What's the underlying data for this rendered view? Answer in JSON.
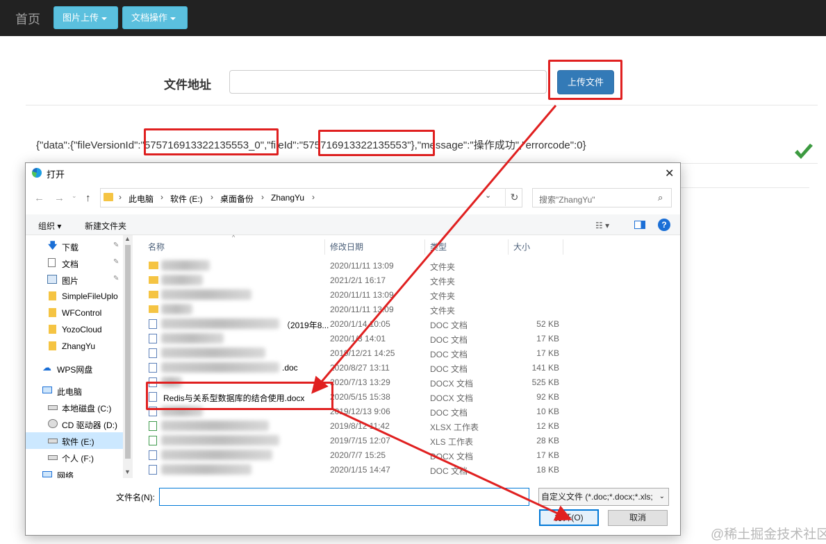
{
  "navbar": {
    "brand": "首页",
    "image_upload": "图片上传",
    "doc_ops": "文档操作"
  },
  "form": {
    "file_address_label": "文件地址",
    "file_address_value": "",
    "upload_button": "上传文件"
  },
  "result": {
    "p1": "{\"data\":{\"fileVersionId\":",
    "p2": "\"575716913322135553_0\"",
    "p3": ",\"fileId\":",
    "p4": "\"575716913322135553\"",
    "p5": "},\"message\":\"操作成功\",\"errorcode\":0}"
  },
  "dialog": {
    "title": "打开",
    "path": [
      "此电脑",
      "软件 (E:)",
      "桌面备份",
      "ZhangYu"
    ],
    "search_placeholder": "搜索\"ZhangYu\"",
    "toolbar": {
      "organize": "组织",
      "new_folder": "新建文件夹"
    },
    "nav_items": [
      {
        "label": "下载",
        "icon": "download-icon",
        "pinned": true
      },
      {
        "label": "文档",
        "icon": "document-icon",
        "pinned": true
      },
      {
        "label": "图片",
        "icon": "picture-icon",
        "pinned": true
      },
      {
        "label": "SimpleFileUplo",
        "icon": "folder-icon",
        "pinned": false
      },
      {
        "label": "WFControl",
        "icon": "folder-icon",
        "pinned": false
      },
      {
        "label": "YozoCloud",
        "icon": "folder-icon",
        "pinned": false
      },
      {
        "label": "ZhangYu",
        "icon": "folder-icon",
        "pinned": false
      },
      {
        "label": "WPS网盘",
        "icon": "cloud-icon",
        "pinned": false
      },
      {
        "label": "此电脑",
        "icon": "computer-icon",
        "pinned": false
      },
      {
        "label": "本地磁盘 (C:)",
        "icon": "drive-icon",
        "pinned": false
      },
      {
        "label": "CD 驱动器 (D:)",
        "icon": "cd-drive-icon",
        "pinned": false
      },
      {
        "label": "软件 (E:)",
        "icon": "drive-icon",
        "pinned": false,
        "selected": true
      },
      {
        "label": "个人 (F:)",
        "icon": "drive-icon",
        "pinned": false
      },
      {
        "label": "网络",
        "icon": "network-icon",
        "pinned": false
      }
    ],
    "columns": {
      "name": "名称",
      "date": "修改日期",
      "type": "类型",
      "size": "大小"
    },
    "files": [
      {
        "name": "",
        "date": "2020/11/11 13:09",
        "type": "文件夹",
        "size": "",
        "kind": "folder",
        "blurred": true
      },
      {
        "name": "",
        "date": "2021/2/1 16:17",
        "type": "文件夹",
        "size": "",
        "kind": "folder",
        "blurred": true
      },
      {
        "name": "",
        "date": "2020/11/11 13:09",
        "type": "文件夹",
        "size": "",
        "kind": "folder",
        "blurred": true
      },
      {
        "name": "",
        "date": "2020/11/11 13:09",
        "type": "文件夹",
        "size": "",
        "kind": "folder",
        "blurred": true
      },
      {
        "name": "（2019年8...",
        "date": "2020/1/14 10:05",
        "type": "DOC 文档",
        "size": "52 KB",
        "kind": "doc",
        "blurred": true
      },
      {
        "name": "",
        "date": "2020/1/3 14:01",
        "type": "DOC 文档",
        "size": "17 KB",
        "kind": "doc",
        "blurred": true
      },
      {
        "name": "",
        "date": "2019/12/21 14:25",
        "type": "DOC 文档",
        "size": "17 KB",
        "kind": "doc",
        "blurred": true
      },
      {
        "name": ".doc",
        "date": "2020/8/27 13:11",
        "type": "DOC 文档",
        "size": "141 KB",
        "kind": "doc",
        "blurred": true
      },
      {
        "name": "",
        "date": "2020/7/13 13:29",
        "type": "DOCX 文档",
        "size": "525 KB",
        "kind": "doc",
        "blurred": true
      },
      {
        "name": "Redis与关系型数据库的结合使用.docx",
        "date": "2020/5/15 15:38",
        "type": "DOCX 文档",
        "size": "92 KB",
        "kind": "doc",
        "blurred": false
      },
      {
        "name": "",
        "date": "2019/12/13 9:06",
        "type": "DOC 文档",
        "size": "10 KB",
        "kind": "doc",
        "blurred": true
      },
      {
        "name": "",
        "date": "2019/8/12 11:42",
        "type": "XLSX 工作表",
        "size": "12 KB",
        "kind": "xls",
        "blurred": true
      },
      {
        "name": "",
        "date": "2019/7/15 12:07",
        "type": "XLS 工作表",
        "size": "28 KB",
        "kind": "xls",
        "blurred": true
      },
      {
        "name": "",
        "date": "2020/7/7 15:25",
        "type": "DOCX 文档",
        "size": "17 KB",
        "kind": "doc",
        "blurred": true
      },
      {
        "name": "",
        "date": "2020/1/15 14:47",
        "type": "DOC 文档",
        "size": "18 KB",
        "kind": "doc",
        "blurred": true
      }
    ],
    "filename_label": "文件名(N):",
    "filename_value": "",
    "filter": "自定义文件 (*.doc;*.docx;*.xls;",
    "open_button": "打开(O)",
    "cancel_button": "取消"
  },
  "watermark": "@稀土掘金技术社区",
  "colors": {
    "navbar_bg": "#222222",
    "info_btn": "#5bc0de",
    "primary_btn": "#337ab7",
    "annotation_red": "#e02020",
    "success_green": "#3c9a40"
  }
}
